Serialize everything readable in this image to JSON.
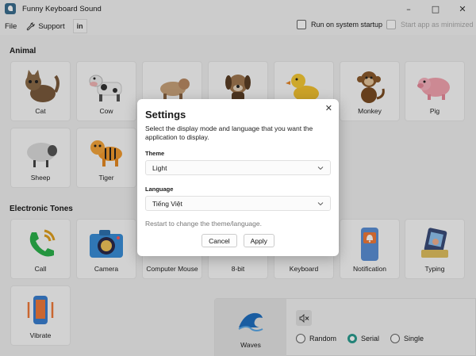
{
  "window": {
    "title": "Funny Keyboard Sound",
    "minimize": "–",
    "maximize": "□",
    "close": "✕"
  },
  "menu": {
    "file": "File",
    "support": "Support",
    "linkedin": "in"
  },
  "options": {
    "run_on_startup": "Run on system startup",
    "start_minimized": "Start app as minimized"
  },
  "sections": {
    "animal": "Animal",
    "electronic": "Electronic Tones"
  },
  "animals": [
    "Cat",
    "Cow",
    "",
    "",
    "",
    "Monkey",
    "Pig",
    "Sheep",
    "Tiger"
  ],
  "tones": [
    "Call",
    "Camera",
    "Computer Mouse",
    "8-bit",
    "Keyboard",
    "Notification",
    "Typing",
    "Vibrate"
  ],
  "bottom": {
    "selected_sound": "Waves",
    "modes": [
      "Random",
      "Serial",
      "Single"
    ],
    "selected_mode": "Serial"
  },
  "dialog": {
    "title": "Settings",
    "description": "Select the display mode and language that you want the application to display.",
    "theme_label": "Theme",
    "theme_value": "Light",
    "language_label": "Language",
    "language_value": "Tiếng Việt",
    "note": "Restart to change the theme/language.",
    "cancel": "Cancel",
    "apply": "Apply",
    "close": "✕"
  },
  "colors": {
    "accent": "#2a9d8f",
    "overlay": "rgba(0,0,0,0.16)"
  }
}
